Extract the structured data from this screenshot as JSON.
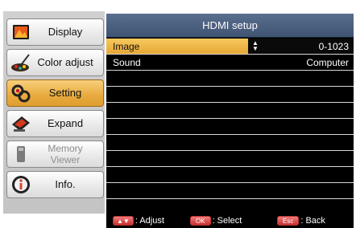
{
  "sidebar": {
    "items": [
      {
        "label": "Display",
        "icon": "display-icon",
        "state": "normal"
      },
      {
        "label": "Color adjust",
        "icon": "color-adjust-icon",
        "state": "normal"
      },
      {
        "label": "Setting",
        "icon": "setting-icon",
        "state": "active"
      },
      {
        "label": "Expand",
        "icon": "expand-icon",
        "state": "normal"
      },
      {
        "label_line1": "Memory",
        "label_line2": "Viewer",
        "icon": "memory-viewer-icon",
        "state": "disabled"
      },
      {
        "label": "Info.",
        "icon": "info-icon",
        "state": "normal"
      }
    ]
  },
  "panel": {
    "title": "HDMI setup",
    "rows": [
      {
        "name": "Image",
        "value": "0-1023",
        "selected": true
      },
      {
        "name": "Sound",
        "value": "Computer",
        "selected": false
      }
    ]
  },
  "footer": {
    "adjust_key": "▲▼",
    "adjust_label": ": Adjust",
    "select_key": "OK",
    "select_label": ": Select",
    "back_key": "Esc",
    "back_label": ": Back"
  },
  "colors": {
    "accent": "#e8a83b",
    "title_bar": "#4a5e7e",
    "panel_bg": "#000000",
    "key_red": "#d13a3a"
  }
}
